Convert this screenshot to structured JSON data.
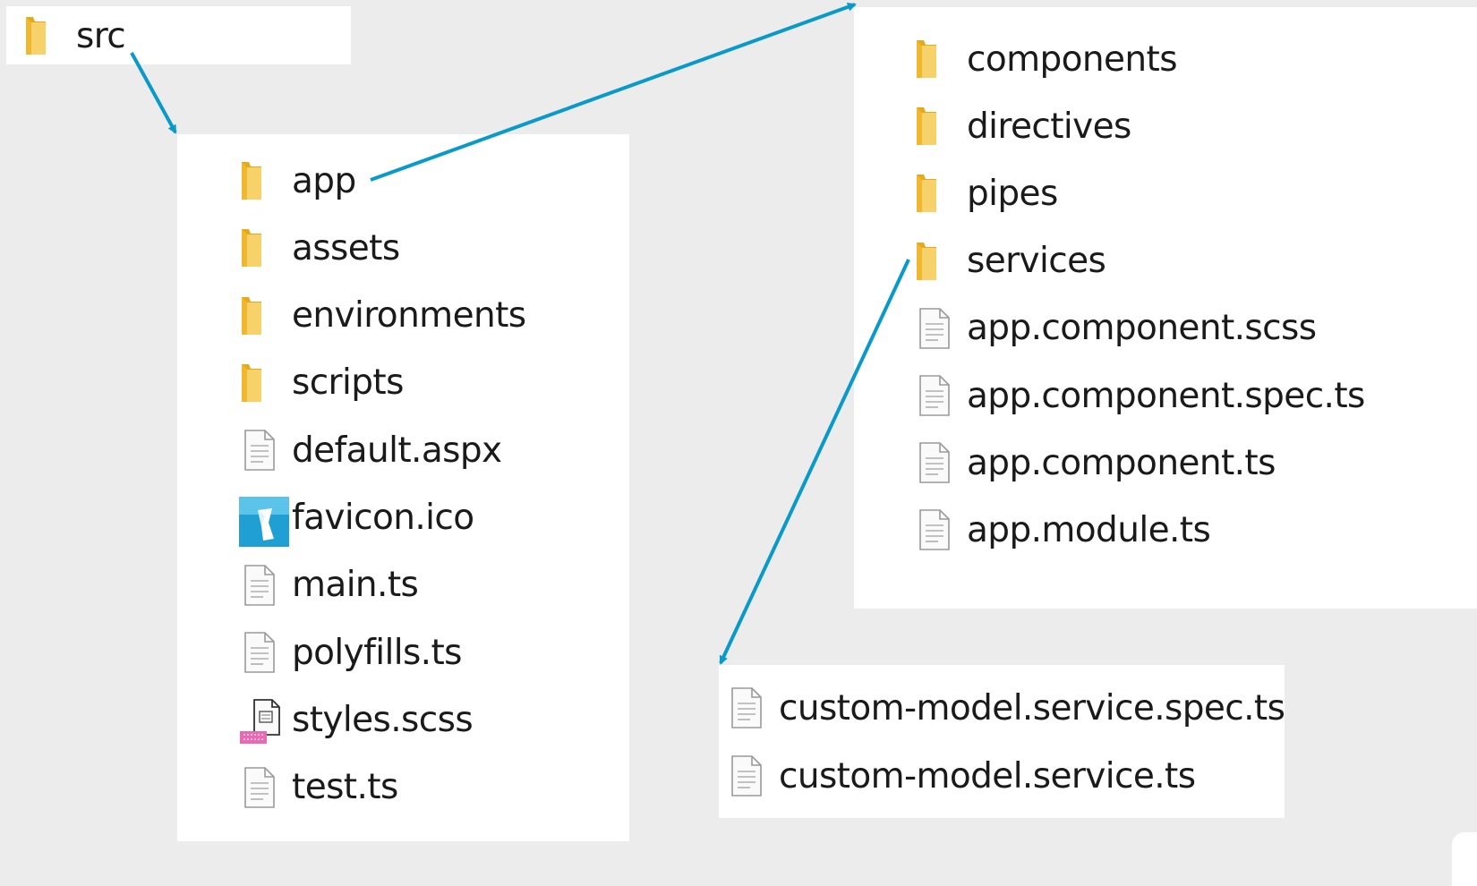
{
  "src_panel": {
    "folder": "src"
  },
  "src_contents": {
    "items": [
      {
        "label": "app",
        "icon": "folder-icon"
      },
      {
        "label": "assets",
        "icon": "folder-icon"
      },
      {
        "label": "environments",
        "icon": "folder-icon"
      },
      {
        "label": "scripts",
        "icon": "folder-icon"
      },
      {
        "label": "default.aspx",
        "icon": "file-icon"
      },
      {
        "label": "favicon.ico",
        "icon": "favicon-icon"
      },
      {
        "label": "main.ts",
        "icon": "file-icon"
      },
      {
        "label": "polyfills.ts",
        "icon": "file-icon"
      },
      {
        "label": "styles.scss",
        "icon": "stylesheet-icon"
      },
      {
        "label": "test.ts",
        "icon": "file-icon"
      }
    ]
  },
  "app_contents": {
    "items": [
      {
        "label": "components",
        "icon": "folder-icon"
      },
      {
        "label": "directives",
        "icon": "folder-icon"
      },
      {
        "label": "pipes",
        "icon": "folder-icon"
      },
      {
        "label": "services",
        "icon": "folder-icon"
      },
      {
        "label": "app.component.scss",
        "icon": "file-icon"
      },
      {
        "label": "app.component.spec.ts",
        "icon": "file-icon"
      },
      {
        "label": "app.component.ts",
        "icon": "file-icon"
      },
      {
        "label": "app.module.ts",
        "icon": "file-icon"
      }
    ]
  },
  "services_contents": {
    "items": [
      {
        "label": "custom-model.service.spec.ts",
        "icon": "file-icon"
      },
      {
        "label": "custom-model.service.ts",
        "icon": "file-icon"
      }
    ]
  },
  "colors": {
    "background": "#ececec",
    "panel": "#ffffff",
    "arrow": "#0a9ac9",
    "folder": "#f4c542",
    "text": "#1a1a1a"
  }
}
